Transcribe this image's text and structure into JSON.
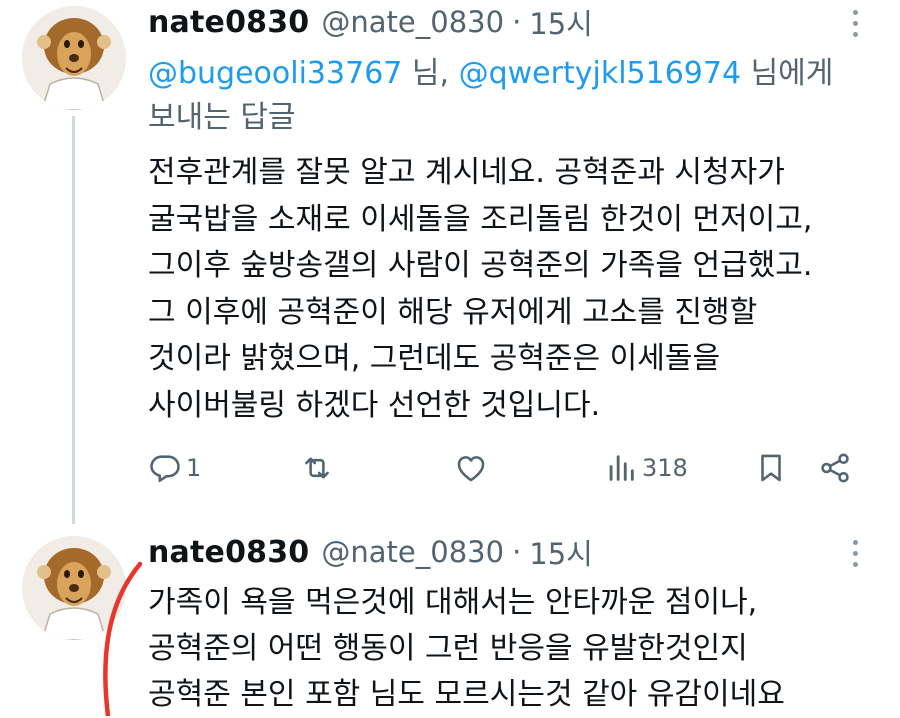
{
  "tweets": [
    {
      "display_name": "nate0830",
      "handle": "@nate_0830",
      "separator": "·",
      "time": "15시",
      "replying_to": {
        "mention1": "@bugeooli33767",
        "mid": " 님, ",
        "mention2": "@qwertyjkl516974",
        "suffix_line1": " 님에게",
        "suffix_line2": "보내는 답글"
      },
      "lines": [
        "전후관계를 잘못 알고 계시네요. 공혁준과 시청자가",
        "굴국밥을 소재로 이세돌을 조리돌림 한것이 먼저이고,",
        "그이후 숲방송갤의 사람이 공혁준의 가족을 언급했고.",
        "그 이후에 공혁준이 해당 유저에게 고소를 진행할",
        "것이라 밝혔으며, 그런데도 공혁준은 이세돌을",
        "사이버불링 하겠다 선언한 것입니다."
      ],
      "actions": {
        "reply_count": "1",
        "views_count": "318"
      }
    },
    {
      "display_name": "nate0830",
      "handle": "@nate_0830",
      "separator": "·",
      "time": "15시",
      "lines": [
        "가족이 욕을 먹은것에 대해서는 안타까운 점이나,",
        "공혁준의 어떤 행동이 그런 반응을 유발한것인지",
        "공혁준 본인 포함 님도 모르시는것 같아 유감이네요"
      ]
    }
  ],
  "icons": {
    "avatar": "cartoon-lion-avatar",
    "more": "more-dots-icon",
    "reply": "reply-icon",
    "retweet": "retweet-icon",
    "like": "heart-icon",
    "views": "views-icon",
    "bookmark": "bookmark-icon",
    "share": "share-icon"
  },
  "colors": {
    "text": "#0f1419",
    "secondary": "#536471",
    "mention": "#1d9bf0",
    "thread_line": "#cfd9de",
    "annotation": "#e8362a"
  }
}
